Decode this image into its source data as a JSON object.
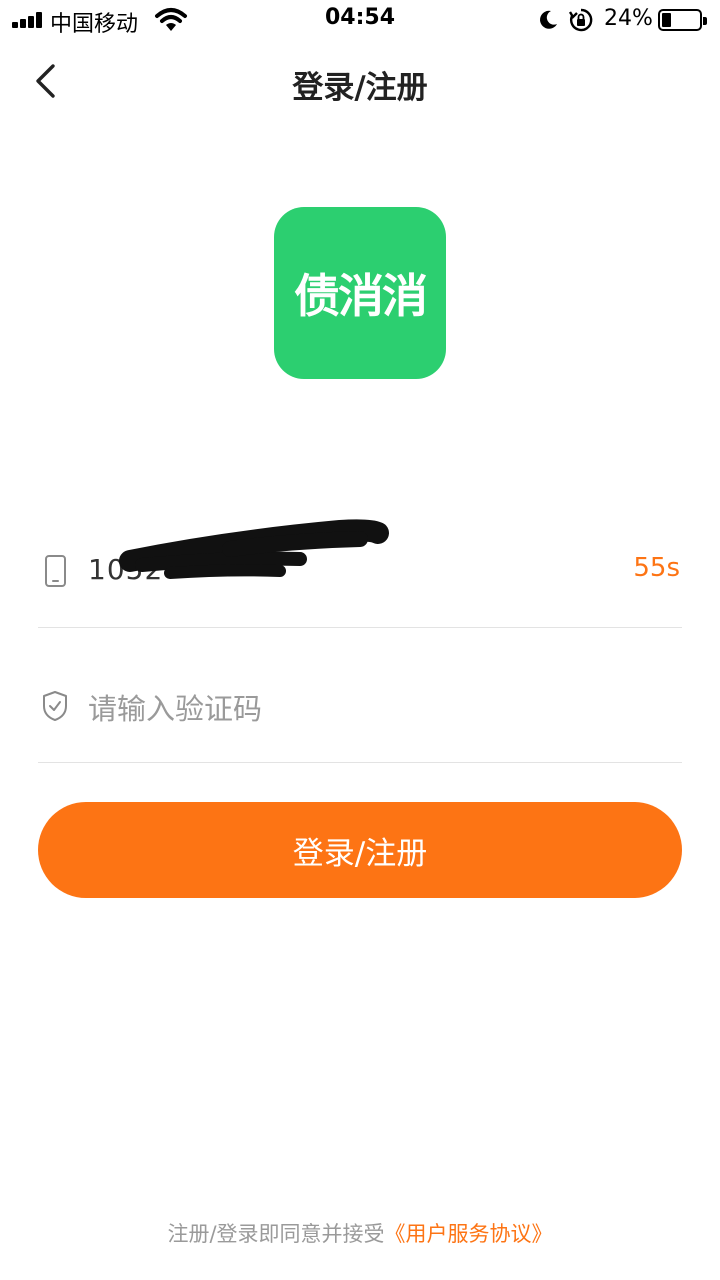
{
  "status_bar": {
    "carrier": "中国移动",
    "time": "04:54",
    "battery_percent": "24%",
    "battery_level": 0.24,
    "icons": [
      "signal-icon",
      "wifi-icon",
      "moon-icon",
      "rotation-lock-icon",
      "battery-icon"
    ]
  },
  "header": {
    "back_icon": "chevron-left-icon",
    "title": "登录/注册"
  },
  "logo": {
    "text": "债消消",
    "background_color": "#2ccf70"
  },
  "form": {
    "phone": {
      "icon": "phone-icon",
      "value": "1052",
      "redacted": true
    },
    "countdown": "55s",
    "code": {
      "icon": "shield-check-icon",
      "value": "",
      "placeholder": "请输入验证码"
    },
    "submit_label": "登录/注册"
  },
  "footer": {
    "agreement_prefix": "注册/登录即同意并接受",
    "agreement_link": "《用户服务协议》"
  },
  "colors": {
    "accent": "#fd7414",
    "logo_green": "#2ccf70",
    "placeholder": "#9a9a9a",
    "divider": "#e3e3e3"
  }
}
